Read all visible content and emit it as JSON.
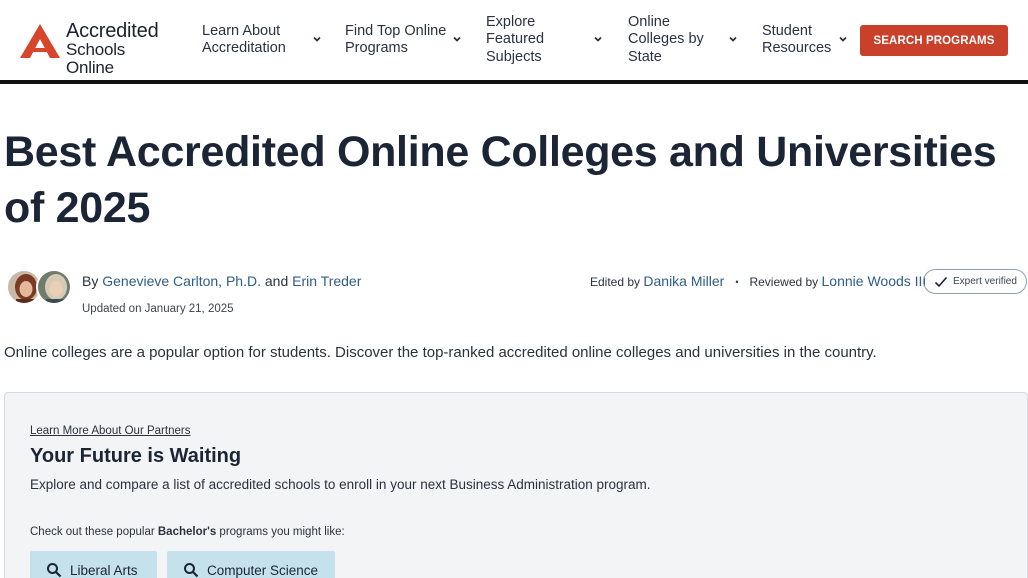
{
  "logo": {
    "line1": "Accredited",
    "line2": "Schools Online",
    "icon": "triangle-a-logo-icon",
    "accent": "#d6462b"
  },
  "nav": {
    "items": [
      {
        "label": "Learn About Accreditation",
        "icon": "chevron-down-icon"
      },
      {
        "label": "Find Top Online Programs",
        "icon": "chevron-down-icon"
      },
      {
        "label": "Explore Featured Subjects",
        "icon": "chevron-down-icon"
      },
      {
        "label": "Online Colleges by State",
        "icon": "chevron-down-icon"
      },
      {
        "label": "Student Resources",
        "icon": "chevron-down-icon"
      }
    ],
    "cta_label": "SEARCH PROGRAMS",
    "cta_color": "#c9412b"
  },
  "article": {
    "title": "Best Accredited Online Colleges and Universities of 2025",
    "byline_prefix": "By",
    "author1": "Genevieve Carlton, Ph.D.",
    "author_joiner": "and",
    "author2": "Erin Treder",
    "updated": "Updated on January 21, 2025",
    "edited_prefix": "Edited by",
    "editor": "Danika Miller",
    "separator": "•",
    "reviewed_prefix": "Reviewed by",
    "reviewer": "Lonnie Woods III",
    "verified_label": "Expert verified",
    "intro": "Online colleges are a popular option for students. Discover the top-ranked accredited online colleges and universities in the country.",
    "link_color": "#2f5c8a"
  },
  "partners": {
    "link_label": "Learn More About Our Partners",
    "heading": "Your Future is Waiting",
    "description": "Explore and compare a list of accredited schools to enroll in your next Business Administration program.",
    "popular_prefix": "Check out these popular",
    "popular_degree": "Bachelor's",
    "popular_suffix": "programs you might like:",
    "programs": [
      {
        "label": "Liberal Arts",
        "icon": "search-icon"
      },
      {
        "label": "Computer Science",
        "icon": "search-icon"
      }
    ],
    "chip_color": "#c4e1ec"
  }
}
